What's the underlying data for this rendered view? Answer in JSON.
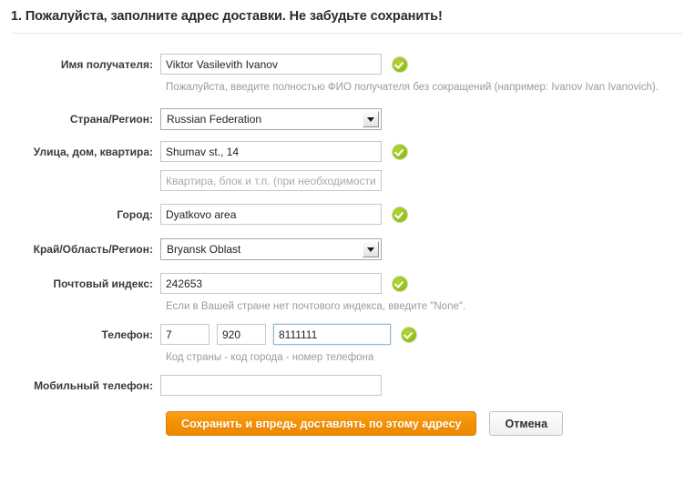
{
  "header": {
    "title": "1. Пожалуйста, заполните адрес доставки. Не забудьте сохранить!"
  },
  "form": {
    "recipient_name": {
      "label": "Имя получателя:",
      "value": "Viktor Vasilevith Ivanov",
      "hint": "Пожалуйста, введите полностью ФИО получателя без сокращений (например: Ivanov Ivan Ivanovich).",
      "valid": true
    },
    "country": {
      "label": "Страна/Регион:",
      "value": "Russian Federation"
    },
    "street": {
      "label": "Улица, дом, квартира:",
      "value": "Shumav st., 14",
      "valid": true
    },
    "street2": {
      "placeholder": "Квартира, блок и т.п. (при необходимости"
    },
    "city": {
      "label": "Город:",
      "value": "Dyatkovo area",
      "valid": true
    },
    "region": {
      "label": "Край/Область/Регион:",
      "value": "Bryansk Oblast"
    },
    "postal_code": {
      "label": "Почтовый индекс:",
      "value": "242653",
      "hint": "Если в Вашей стране нет почтового индекса, введите \"None\".",
      "valid": true
    },
    "phone": {
      "label": "Телефон:",
      "country_code": "7",
      "area_code": "920",
      "number": "8111111",
      "hint": "Код страны - код города - номер телефона",
      "valid": true
    },
    "mobile_phone": {
      "label": "Мобильный телефон:",
      "value": ""
    }
  },
  "actions": {
    "save_label": "Сохранить и впредь доставлять по этому адресу",
    "cancel_label": "Отмена"
  },
  "colors": {
    "accent_orange": "#f59000",
    "valid_green": "#97c21d",
    "hint_gray": "#9b9b9b"
  }
}
